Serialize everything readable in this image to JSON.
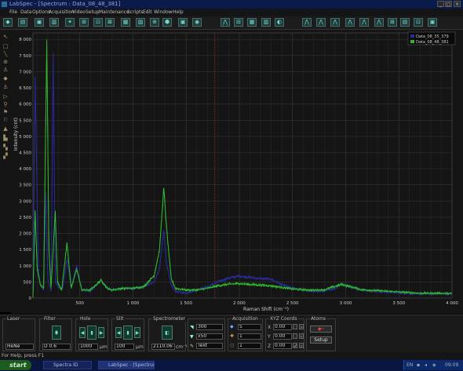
{
  "window": {
    "title": "LabSpec - [Spectrum : Data_08_48_381]"
  },
  "menu": [
    "File",
    "Data",
    "Options",
    "Acquisition",
    "Video",
    "Setup",
    "Maintenance",
    "Scripts",
    "Edit",
    "Window",
    "Help"
  ],
  "toolbar_icons": [
    "logo-icon",
    "open-icon",
    "save-icon",
    "print-icon",
    "cursor-icon",
    "measure-icon",
    "baseline-icon",
    "zoom-icon",
    "fit-icon",
    "grid-icon",
    "map-icon",
    "table-icon",
    "camera-icon",
    "eye-icon",
    "peak-icon",
    "overlay-icon",
    "spectra-icon",
    "multi-icon",
    "filter-icon",
    "chart-icon",
    "stack-icon",
    "export-icon",
    "config-icon"
  ],
  "left_tools": [
    "pointer-icon",
    "rectangle-icon",
    "line-icon",
    "zoom-icon",
    "marker-icon",
    "diamond-icon",
    "peak-icon",
    "arrow-icon",
    "person-icon",
    "baseline-icon",
    "flag-icon",
    "tag-icon",
    "bookmark-icon",
    "note-icon",
    "region-icon"
  ],
  "chart_data": {
    "type": "line",
    "xlabel": "Raman Shift (cm⁻¹)",
    "ylabel": "Intensity (cnt)",
    "xlim": [
      60,
      4000
    ],
    "ylim": [
      0,
      8200
    ],
    "x_ticks": [
      "500",
      "1 000",
      "1 500",
      "2 000",
      "2 500",
      "3 000",
      "3 500",
      "4 000"
    ],
    "x_tick_values": [
      500,
      1000,
      1500,
      2000,
      2500,
      3000,
      3500,
      4000
    ],
    "y_ticks": [
      "0",
      "500",
      "1 000",
      "1 500",
      "2 000",
      "2 500",
      "3 000",
      "3 500",
      "4 000",
      "4 500",
      "5 000",
      "5 500",
      "6 000",
      "6 500",
      "7 000",
      "7 500",
      "8 000"
    ],
    "y_tick_values": [
      0,
      500,
      1000,
      1500,
      2000,
      2500,
      3000,
      3500,
      4000,
      4500,
      5000,
      5500,
      6000,
      6500,
      7000,
      7500,
      8000
    ],
    "grid": true,
    "cursor_x": 1770,
    "legend": "top-right",
    "series": [
      {
        "name": "Data_08_35_379",
        "color": "#2a2a9a",
        "points": [
          [
            60,
            0
          ],
          [
            80,
            6800
          ],
          [
            95,
            4000
          ],
          [
            110,
            900
          ],
          [
            130,
            400
          ],
          [
            160,
            250
          ],
          [
            180,
            3200
          ],
          [
            200,
            600
          ],
          [
            230,
            200
          ],
          [
            250,
            7600
          ],
          [
            270,
            500
          ],
          [
            300,
            350
          ],
          [
            340,
            300
          ],
          [
            380,
            1200
          ],
          [
            420,
            300
          ],
          [
            470,
            1000
          ],
          [
            520,
            250
          ],
          [
            600,
            200
          ],
          [
            700,
            550
          ],
          [
            760,
            300
          ],
          [
            800,
            250
          ],
          [
            900,
            300
          ],
          [
            1000,
            300
          ],
          [
            1100,
            350
          ],
          [
            1200,
            500
          ],
          [
            1250,
            900
          ],
          [
            1290,
            2100
          ],
          [
            1320,
            1000
          ],
          [
            1360,
            400
          ],
          [
            1400,
            200
          ],
          [
            1500,
            150
          ],
          [
            1600,
            250
          ],
          [
            1700,
            350
          ],
          [
            1800,
            500
          ],
          [
            1900,
            620
          ],
          [
            2000,
            680
          ],
          [
            2100,
            640
          ],
          [
            2200,
            600
          ],
          [
            2300,
            580
          ],
          [
            2400,
            420
          ],
          [
            2500,
            300
          ],
          [
            2600,
            250
          ],
          [
            2700,
            200
          ],
          [
            2800,
            220
          ],
          [
            2900,
            300
          ],
          [
            2960,
            450
          ],
          [
            3050,
            350
          ],
          [
            3150,
            250
          ],
          [
            3300,
            200
          ],
          [
            3500,
            160
          ],
          [
            3700,
            130
          ],
          [
            3900,
            140
          ],
          [
            4000,
            120
          ]
        ]
      },
      {
        "name": "Data_08_48_381",
        "color": "#2eb82e",
        "points": [
          [
            60,
            0
          ],
          [
            80,
            2700
          ],
          [
            100,
            900
          ],
          [
            130,
            400
          ],
          [
            160,
            300
          ],
          [
            190,
            8000
          ],
          [
            210,
            1500
          ],
          [
            230,
            300
          ],
          [
            270,
            2700
          ],
          [
            290,
            500
          ],
          [
            330,
            250
          ],
          [
            380,
            1700
          ],
          [
            420,
            300
          ],
          [
            470,
            900
          ],
          [
            520,
            250
          ],
          [
            600,
            250
          ],
          [
            700,
            550
          ],
          [
            760,
            300
          ],
          [
            800,
            250
          ],
          [
            900,
            300
          ],
          [
            1000,
            300
          ],
          [
            1100,
            350
          ],
          [
            1200,
            700
          ],
          [
            1250,
            1500
          ],
          [
            1290,
            3400
          ],
          [
            1320,
            2000
          ],
          [
            1360,
            600
          ],
          [
            1400,
            300
          ],
          [
            1500,
            250
          ],
          [
            1600,
            250
          ],
          [
            1700,
            300
          ],
          [
            1800,
            380
          ],
          [
            1900,
            430
          ],
          [
            2000,
            450
          ],
          [
            2100,
            420
          ],
          [
            2200,
            400
          ],
          [
            2300,
            380
          ],
          [
            2400,
            330
          ],
          [
            2500,
            280
          ],
          [
            2600,
            260
          ],
          [
            2700,
            240
          ],
          [
            2800,
            260
          ],
          [
            2900,
            360
          ],
          [
            2960,
            420
          ],
          [
            3050,
            350
          ],
          [
            3150,
            260
          ],
          [
            3300,
            230
          ],
          [
            3500,
            190
          ],
          [
            3700,
            150
          ],
          [
            3900,
            150
          ],
          [
            4000,
            140
          ]
        ]
      }
    ]
  },
  "panel": {
    "laser": {
      "caption": "Laser",
      "value": "HeNe"
    },
    "filter": {
      "caption": "Filter",
      "value": "D 0.6"
    },
    "hole": {
      "caption": "Hole",
      "value": "1000",
      "unit": "µm"
    },
    "slit": {
      "caption": "Slit",
      "value": "100",
      "unit": "µm"
    },
    "spectrometer": {
      "caption": "Spectrometer",
      "value": "2110.06",
      "unit": "cm⁻¹"
    },
    "grating": {
      "value": "300"
    },
    "objective": {
      "value": "x50"
    },
    "mode": {
      "value": "Text"
    },
    "acquisition": {
      "caption": "Acquisition",
      "time": "5",
      "accum": "1",
      "extra": "1"
    },
    "xyz": {
      "caption": "XYZ Coords",
      "x_label": "X",
      "x_value": "0.00",
      "y_label": "Y",
      "y_value": "0.00",
      "z_label": "Z",
      "z_value": "0.00"
    },
    "atoms": {
      "caption": "Atoms",
      "setup_label": "Setup"
    }
  },
  "status": {
    "text": "For Help, press F1"
  },
  "taskbar": {
    "start_label": "start",
    "tasks": [
      "Spectra ID",
      "LabSpec - [Spectrum ..."
    ],
    "tray_lang": "EN",
    "tray_time": "09:09"
  }
}
